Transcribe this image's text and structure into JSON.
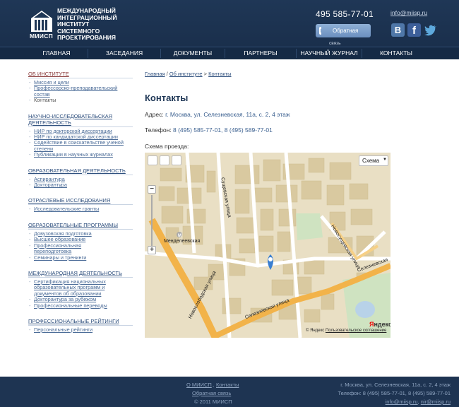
{
  "header": {
    "logo_abbr": "МИИСП",
    "logo_lines": [
      "МЕЖДУНАРОДНЫЙ",
      "ИНТЕГРАЦИОННЫЙ",
      "ИНСТИТУТ",
      "СИСТЕМНОГО",
      "ПРОЕКТИРОВАНИЯ"
    ],
    "phone": "495 585-77-01",
    "callback_label": "Обратная",
    "callback_sub": "связь",
    "email": "info@miisp.ru",
    "social": {
      "vk": "B",
      "fb": "f"
    }
  },
  "nav": [
    "ГЛАВНАЯ",
    "ЗАСЕДАНИЯ",
    "ДОКУМЕНТЫ",
    "ПАРТНЕРЫ",
    "НАУЧНЫЙ ЖУРНАЛ",
    "КОНТАКТЫ"
  ],
  "sidebar": {
    "s0": {
      "title": "ОБ ИНСТИТУТЕ",
      "items": [
        "Миссия и цели",
        "Профессорско-преподавательский состав",
        "Контакты"
      ]
    },
    "s1": {
      "title": "НАУЧНО-ИССЛЕДОВАТЕЛЬСКАЯ ДЕЯТЕЛЬНОСТЬ",
      "items": [
        "НИР по докторской диссертации",
        "НИР по кандидатской диссертации",
        "Содействие в соискательстве ученой степени",
        "Публикации в научных журналах"
      ]
    },
    "s2": {
      "title": "ОБРАЗОВАТЕЛЬНАЯ ДЕЯТЕЛЬНОСТЬ",
      "items": [
        "Аспирантура",
        "Докторантура"
      ]
    },
    "s3": {
      "title": "ОТРАСЛЕВЫЕ ИССЛЕДОВАНИЯ",
      "items": [
        "Исследовательские гранты"
      ]
    },
    "s4": {
      "title": "ОБРАЗОВАТЕЛЬНЫЕ ПРОГРАММЫ",
      "items": [
        "Довузовская подготовка",
        "Высшее образование",
        "Профессиональная переподготовка",
        "Семинары и тренинги"
      ]
    },
    "s5": {
      "title": "МЕЖДУНАРОДНАЯ ДЕЯТЕЛЬНОСТЬ",
      "items": [
        "Сертификация национальных образовательных программ и документов об образовании",
        "Докторантура за рубежом",
        "Профессиональные переводы"
      ]
    },
    "s6": {
      "title": "ПРОФЕССИОНАЛЬНЫЕ РЕЙТИНГИ",
      "items": [
        "Персональные рейтинги"
      ]
    }
  },
  "breadcrumb": {
    "home": "Главная",
    "sep": "/",
    "section": "Об институте",
    "arrow": ">",
    "current": "Контакты"
  },
  "main": {
    "title": "Контакты",
    "address_label": "Адрес:",
    "address_value": "г. Москва, ул. Селезневская, 11а, с. 2, 4 этаж",
    "phone_label": "Телефон:",
    "phone_value": "8 (495) 585-77-01, 8 (495) 589-77-01",
    "scheme_label": "Схема проезда:"
  },
  "map": {
    "view_label": "Схема",
    "metro": "Менделеевская",
    "streets": {
      "street1": "Новослободская улица",
      "street2": "Селезневская улица",
      "street3": "Сущевская улица",
      "street4": "Новосущевская улица",
      "street5": "Селезневская",
      "street6": "Селезневская"
    },
    "copyright": "© Яндекс",
    "terms": "Пользовательское соглашение",
    "brand": "Яндекс",
    "colors": {
      "ground": "#e9dfc4",
      "building": "#d8c79e",
      "major_road": "#f2b34a",
      "road": "#ffffff",
      "park": "#cfe3c1",
      "water": "#b8d2e8",
      "marker": "#3b7fd0"
    }
  },
  "footer": {
    "about": "О МИИСП",
    "contacts": "Контакты",
    "feedback": "Обратная связь",
    "copyright": "© 2011 МИИСП",
    "address": "г. Москва, ул. Селезневская, 11а, с. 2, 4 этаж",
    "phone": "Телефон: 8 (495) 585-77-01, 8 (495) 589-77-01",
    "email1": "info@miisp.ru",
    "email_sep": ",",
    "email2": "nir@miisp.ru"
  }
}
